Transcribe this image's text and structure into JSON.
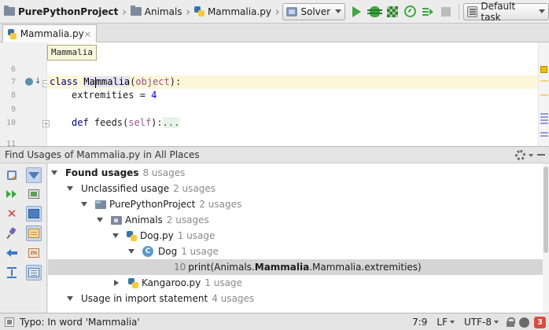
{
  "navbar": {
    "crumbs": [
      {
        "label": "PurePythonProject",
        "icon": "folder-icon"
      },
      {
        "label": "Animals",
        "icon": "folder-icon"
      },
      {
        "label": "Mammalia.py",
        "icon": "python-file-icon"
      }
    ]
  },
  "run_config": {
    "label": "Solver"
  },
  "task_selector": {
    "label": "Default task"
  },
  "editor_tab": {
    "label": "Mammalia.py",
    "close": "×"
  },
  "editor": {
    "tooltip": "Mammalia",
    "line_numbers": [
      "6",
      "7",
      "8",
      "9",
      "10",
      "11"
    ],
    "code": {
      "line7": {
        "kw": "class",
        "name_a": "Ma",
        "name_b": "mmalia",
        "paren_open": "(",
        "base": "object",
        "paren_close": "):"
      },
      "line8": {
        "text": "extremities = ",
        "value": "4"
      },
      "line10": {
        "kw": "def",
        "name": " feeds(",
        "param": "self",
        "close": "):",
        "ellipsis": "..."
      }
    }
  },
  "find_usages": {
    "title": "Find Usages of Mammalia.py in All Places",
    "tree": {
      "root": {
        "label": "Found usages",
        "count": "8 usages"
      },
      "unclassified": {
        "label": "Unclassified usage",
        "count": "2 usages"
      },
      "project": {
        "label": "PurePythonProject",
        "count": "2 usages"
      },
      "animals": {
        "label": "Animals",
        "count": "2 usages"
      },
      "dogpy": {
        "label": "Dog.py",
        "count": "1 usage"
      },
      "dog": {
        "label": "Dog",
        "count": "1 usage"
      },
      "usage": {
        "line": "10",
        "prefix": "print(Animals.",
        "match": "Mammalia",
        "suffix": ".Mammalia.extremities)"
      },
      "kangaroo": {
        "label": "Kangaroo.py",
        "count": "1 usage"
      },
      "import_stmt": {
        "label": "Usage in import statement",
        "count": "4 usages"
      }
    }
  },
  "status_bar": {
    "message": "Typo: In word 'Mammalia'",
    "position": "7:9",
    "line_sep": "LF",
    "encoding": "UTF-8",
    "notifications": "3"
  }
}
